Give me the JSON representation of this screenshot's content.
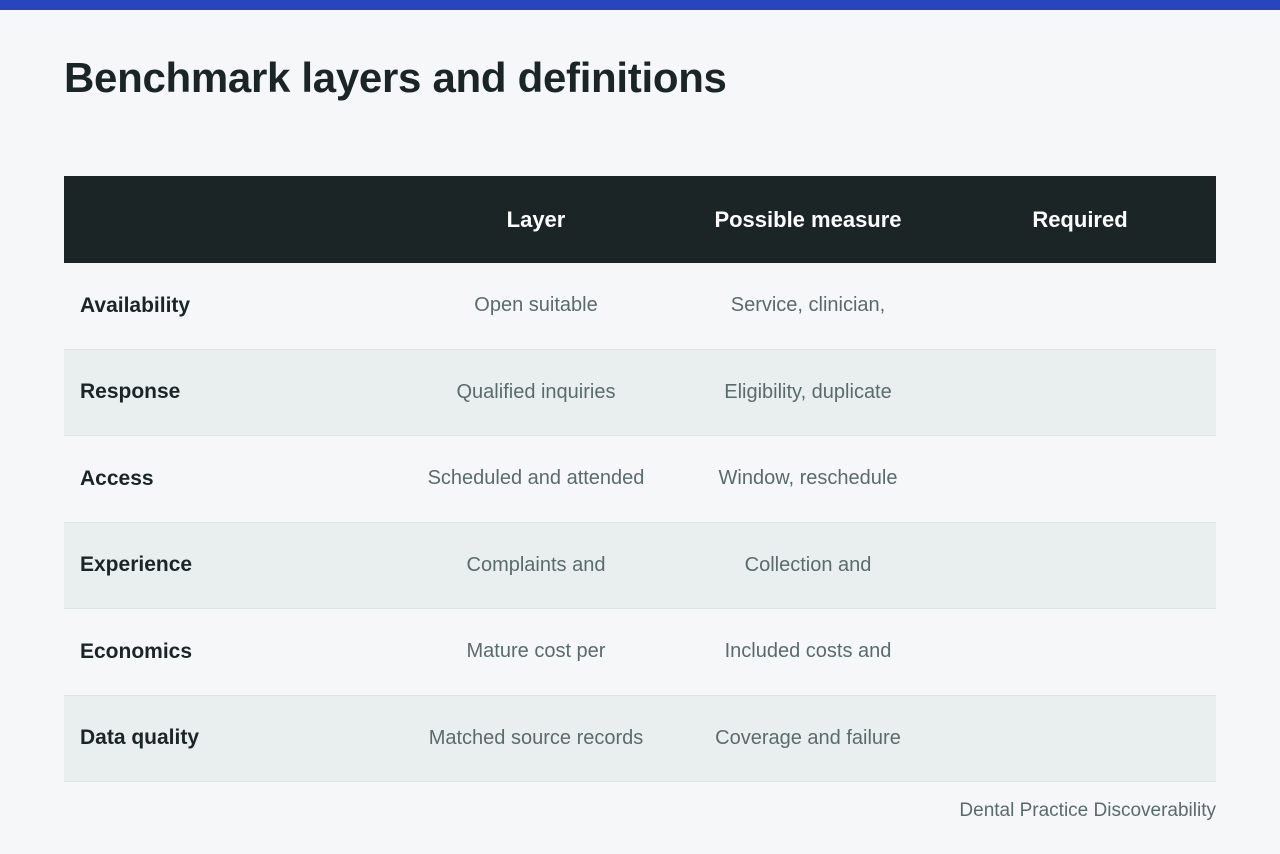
{
  "header": {
    "accent_color": "#2746bd",
    "title": "Benchmark layers and definitions"
  },
  "table": {
    "columns": [
      "",
      "Layer",
      "Possible measure",
      "Required"
    ],
    "rows": [
      {
        "label": "Availability",
        "layer": "Open suitable",
        "measure": "Service, clinician,",
        "required": ""
      },
      {
        "label": "Response",
        "layer": "Qualified inquiries",
        "measure": "Eligibility, duplicate",
        "required": ""
      },
      {
        "label": "Access",
        "layer": "Scheduled and attended",
        "measure": "Window, reschedule",
        "required": ""
      },
      {
        "label": "Experience",
        "layer": "Complaints and",
        "measure": "Collection and",
        "required": ""
      },
      {
        "label": "Economics",
        "layer": "Mature cost per",
        "measure": "Included costs and",
        "required": ""
      },
      {
        "label": "Data quality",
        "layer": "Matched source records",
        "measure": "Coverage and failure",
        "required": ""
      }
    ]
  },
  "footer": {
    "source": "Dental Practice Discoverability"
  }
}
